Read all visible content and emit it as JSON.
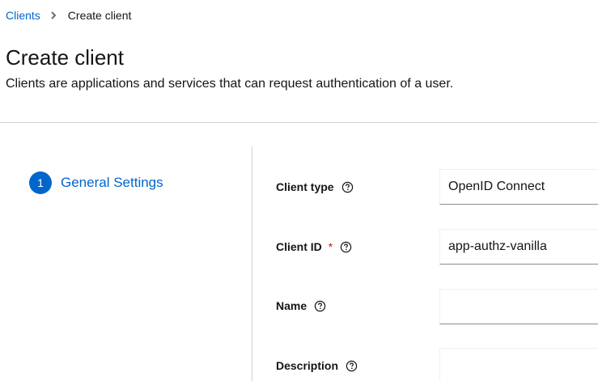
{
  "breadcrumb": {
    "parent": "Clients",
    "current": "Create client"
  },
  "header": {
    "title": "Create client",
    "description": "Clients are applications and services that can request authentication of a user."
  },
  "wizard": {
    "steps": [
      {
        "number": "1",
        "label": "General Settings",
        "active": true
      }
    ]
  },
  "form": {
    "client_type": {
      "label": "Client type",
      "value": "OpenID Connect",
      "help_icon": "help-circle-icon"
    },
    "client_id": {
      "label": "Client ID",
      "required_mark": "*",
      "value": "app-authz-vanilla",
      "help_icon": "help-circle-icon"
    },
    "name": {
      "label": "Name",
      "value": "",
      "help_icon": "help-circle-icon"
    },
    "description": {
      "label": "Description",
      "value": "",
      "help_icon": "help-circle-icon"
    }
  },
  "colors": {
    "accent": "#0066cc",
    "required": "#c9190b",
    "divider": "#d2d2d2"
  }
}
